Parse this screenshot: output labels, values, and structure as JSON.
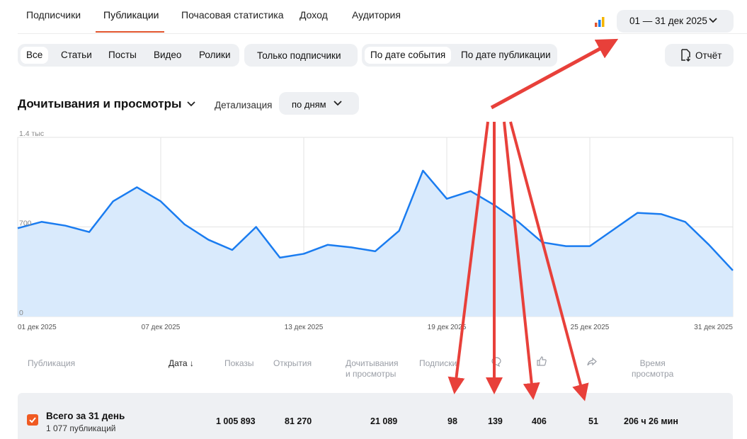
{
  "tabs": [
    {
      "label": "Подписчики"
    },
    {
      "label": "Публикации"
    },
    {
      "label": "Почасовая статистика"
    },
    {
      "label": "Доход"
    },
    {
      "label": "Аудитория"
    }
  ],
  "date_range": {
    "label": "01 — 31 дек 2025"
  },
  "filters": {
    "type": [
      "Все",
      "Статьи",
      "Посты",
      "Видео",
      "Ролики"
    ],
    "subscribers_only": "Только подписчики",
    "date_mode": [
      "По дате события",
      "По дате публикации"
    ]
  },
  "report_button": {
    "label": "Отчёт"
  },
  "section": {
    "title": "Дочитывания и просмотры",
    "detail_label": "Детализация",
    "detail_value": "по дням"
  },
  "chart_data": {
    "type": "area",
    "ylim": [
      0,
      1400
    ],
    "y_ticks": [
      "1.4 тыс",
      "700",
      "0"
    ],
    "x_tick_labels": [
      "01 дек 2025",
      "07 дек 2025",
      "13 дек 2025",
      "19 дек 2025",
      "25 дек 2025",
      "31 дек 2025"
    ],
    "x": [
      1,
      2,
      3,
      4,
      5,
      6,
      7,
      8,
      9,
      10,
      11,
      12,
      13,
      14,
      15,
      16,
      17,
      18,
      19,
      20,
      21,
      22,
      23,
      24,
      25,
      26,
      27,
      28,
      29,
      30,
      31
    ],
    "values": [
      690,
      740,
      710,
      660,
      900,
      1010,
      900,
      720,
      600,
      520,
      700,
      460,
      490,
      560,
      540,
      510,
      670,
      1140,
      920,
      980,
      870,
      740,
      580,
      550,
      550,
      680,
      810,
      800,
      740,
      560,
      360
    ],
    "grid": true,
    "color": "#1a7cf0",
    "fill": "#d9eafc"
  },
  "table": {
    "headers": [
      "Публикация",
      "Дата",
      "Показы",
      "Открытия",
      "Дочитывания\nи просмотры",
      "Подписки",
      "",
      "",
      "",
      "Время\nпросмотра"
    ],
    "total": {
      "title": "Всего за 31 день",
      "subtitle": "1 077 публикаций",
      "values": [
        "1 005 893",
        "81 270",
        "21 089",
        "98",
        "139",
        "406",
        "51",
        "206 ч 26 мин"
      ]
    }
  },
  "colors": {
    "accent": "#e2552e",
    "annotation_arrow": "#e8403a"
  }
}
